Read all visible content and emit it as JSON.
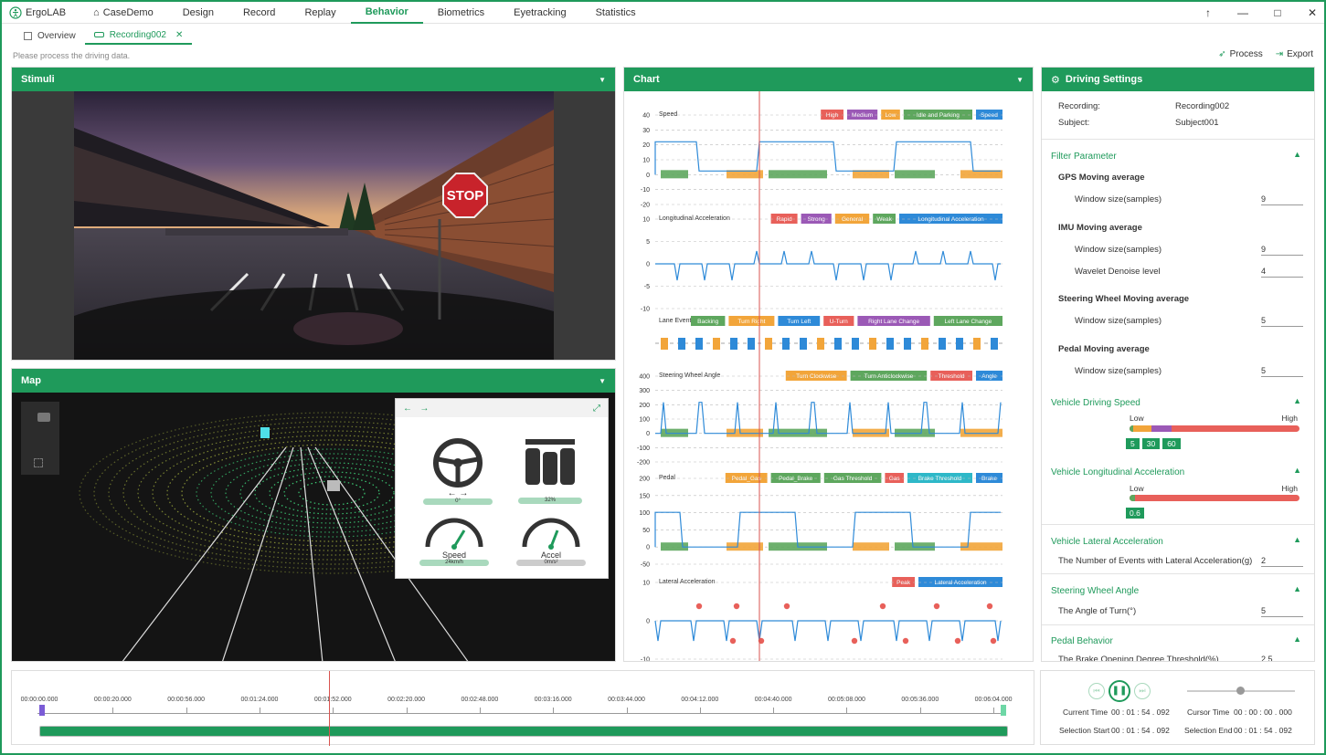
{
  "app": {
    "brand": "ErgoLAB"
  },
  "menu": [
    "CaseDemo",
    "Design",
    "Record",
    "Replay",
    "Behavior",
    "Biometrics",
    "Eyetracking",
    "Statistics"
  ],
  "menu_active": "Behavior",
  "tabs": [
    {
      "label": "Overview"
    },
    {
      "label": "Recording002"
    }
  ],
  "hint": "Please process the driving data.",
  "actions": {
    "process": "Process",
    "export": "Export"
  },
  "panels": {
    "stimuli": "Stimuli",
    "map": "Map",
    "chart": "Chart",
    "settings": "Driving Settings"
  },
  "stimuli": {
    "sign": "STOP"
  },
  "dashboard": {
    "steering_value": "0°",
    "pedal_value": "32%",
    "speed_label": "Speed",
    "speed_value": "24km/h",
    "accel_label": "Accel",
    "accel_value": "0m/s²"
  },
  "settings": {
    "recording_label": "Recording:",
    "recording_value": "Recording002",
    "subject_label": "Subject:",
    "subject_value": "Subject001",
    "filter_title": "Filter Parameter",
    "gps_title": "GPS Moving average",
    "gps_window_label": "Window size(samples)",
    "gps_window_value": "9",
    "imu_title": "IMU Moving average",
    "imu_window_label": "Window size(samples)",
    "imu_window_value": "9",
    "imu_wavelet_label": "Wavelet Denoise level",
    "imu_wavelet_value": "4",
    "steer_title": "Steering Wheel Moving average",
    "steer_window_label": "Window size(samples)",
    "steer_window_value": "5",
    "pedal_title": "Pedal Moving average",
    "pedal_window_label": "Window size(samples)",
    "pedal_window_value": "5",
    "speed_title": "Vehicle Driving Speed",
    "low": "Low",
    "high": "High",
    "speed_thresholds": [
      "5",
      "30",
      "60"
    ],
    "long_title": "Vehicle Longitudinal Acceleration",
    "long_thresholds": [
      "0.6"
    ],
    "lat_title": "Vehicle Lateral Acceleration",
    "lat_label": "The Number of Events with Lateral Acceleration(g)",
    "lat_value": "2",
    "steer_angle_title": "Steering Wheel Angle",
    "steer_angle_label": "The Angle of Turn(°)",
    "steer_angle_value": "5",
    "pedal_behavior_title": "Pedal Behavior",
    "pedal_behavior_label": "The Brake Opening Degree Threshold(%)",
    "pedal_behavior_value": "2.5"
  },
  "timeline": {
    "ticks": [
      "00:00:00.000",
      "00:00:20.000",
      "00:00:56.000",
      "00:01:24.000",
      "00:01:52.000",
      "00:02:20.000",
      "00:02:48.000",
      "00:03:16.000",
      "00:03:44.000",
      "00:04:12.000",
      "00:04:40.000",
      "00:05:08.000",
      "00:05:36.000",
      "00:06:04.000"
    ]
  },
  "controls": {
    "current_time_label": "Current Time",
    "current_time": "00 : 01 : 54 . 092",
    "cursor_time_label": "Cursor Time",
    "cursor_time": "00 : 00 : 00 . 000",
    "sel_start_label": "Selection Start",
    "sel_start": "00 : 01 : 54 . 092",
    "sel_end_label": "Selection End",
    "sel_end": "00 : 01 : 54 . 092"
  },
  "colors": {
    "accent": "#1f9a5b",
    "high": "#e8605a",
    "medium": "#9b59b6",
    "low": "#f2a53a",
    "idle": "#5ea75e",
    "speed": "#2e8ad8"
  },
  "chart_data": [
    {
      "type": "line",
      "title": "Speed",
      "y_ticks": [
        40,
        30,
        20,
        10,
        0,
        -10,
        -20
      ],
      "legend": [
        "High",
        "Medium",
        "Low",
        "Idle and Parking",
        "Speed"
      ]
    },
    {
      "type": "line",
      "title": "Longitudinal Acceleration",
      "y_ticks": [
        10,
        5,
        0,
        -5,
        -10
      ],
      "legend": [
        "Rapid",
        "Strong",
        "General",
        "Weak",
        "Longitudinal Acceleration"
      ]
    },
    {
      "type": "bar",
      "title": "Lane Event",
      "y_ticks": [],
      "legend": [
        "Backing",
        "Turn Right",
        "Turn Left",
        "U-Turn",
        "Right Lane Change",
        "Left Lane Change"
      ]
    },
    {
      "type": "line",
      "title": "Steering Wheel Angle",
      "y_ticks": [
        400,
        300,
        200,
        100,
        0,
        -100,
        -200
      ],
      "legend": [
        "Turn Clockwise",
        "Turn Anticlockwise",
        "Threshold",
        "Angle"
      ]
    },
    {
      "type": "line",
      "title": "Pedal",
      "y_ticks": [
        200,
        150,
        100,
        50,
        0,
        -50
      ],
      "legend": [
        "Pedal_Gas",
        "Pedal_Brake",
        "Gas Threshold",
        "Gas",
        "Brake Threshold",
        "Brake"
      ]
    },
    {
      "type": "line",
      "title": "Lateral Acceleration",
      "y_ticks": [
        10,
        0,
        -10
      ],
      "legend": [
        "Peak",
        "Lateral Acceleration"
      ]
    }
  ]
}
